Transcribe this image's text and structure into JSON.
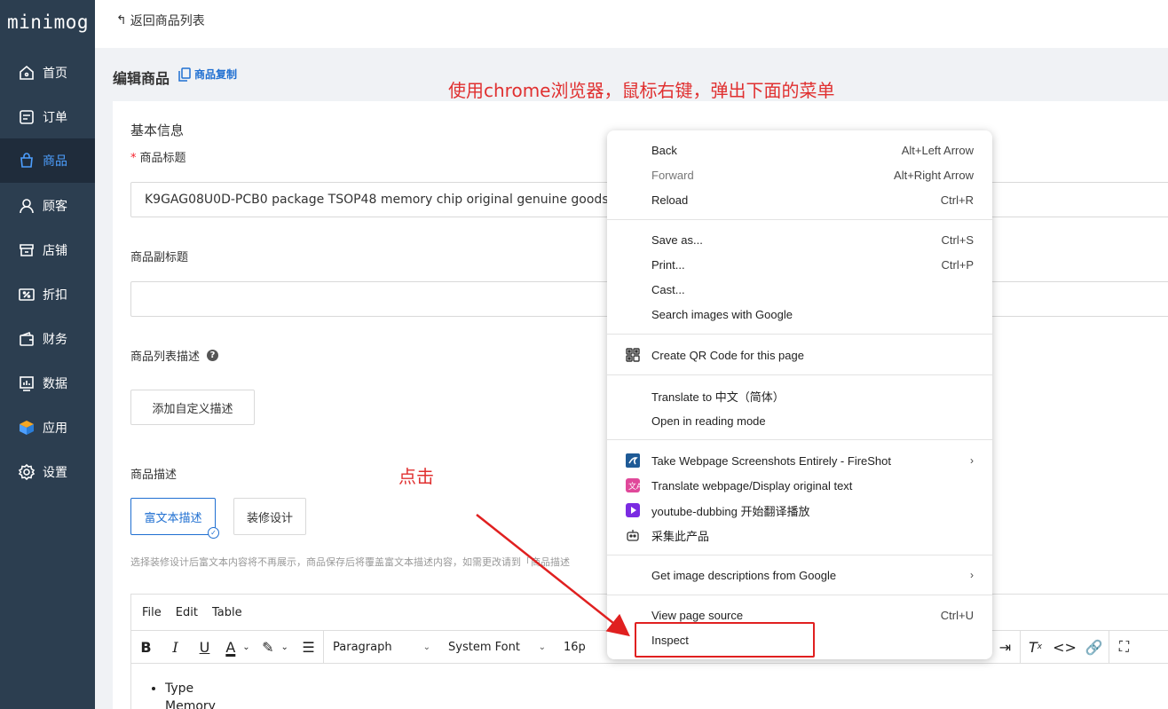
{
  "logo": "minimog",
  "sidebar": {
    "items": [
      {
        "label": "首页",
        "icon": "home-icon"
      },
      {
        "label": "订单",
        "icon": "order-icon"
      },
      {
        "label": "商品",
        "icon": "bag-icon"
      },
      {
        "label": "顾客",
        "icon": "user-icon"
      },
      {
        "label": "店铺",
        "icon": "store-icon"
      },
      {
        "label": "折扣",
        "icon": "discount-icon"
      },
      {
        "label": "财务",
        "icon": "wallet-icon"
      },
      {
        "label": "数据",
        "icon": "chart-icon"
      },
      {
        "label": "应用",
        "icon": "box-icon"
      },
      {
        "label": "设置",
        "icon": "gear-icon"
      }
    ],
    "active_index": 2
  },
  "topbar": {
    "back_label": "返回商品列表"
  },
  "page": {
    "title": "编辑商品",
    "copy_label": "商品复制"
  },
  "annotations": {
    "top": "使用chrome浏览器，鼠标右键，弹出下面的菜单",
    "click": "点击"
  },
  "form": {
    "section_title": "基本信息",
    "title_label": "商品标题",
    "title_value": "K9GAG08U0D-PCB0 package TSOP48 memory chip original genuine goods",
    "subtitle_label": "商品副标题",
    "subtitle_value": "",
    "list_desc_label": "商品列表描述",
    "add_custom_desc": "添加自定义描述",
    "desc_label": "商品描述",
    "tab_rich": "富文本描述",
    "tab_design": "装修设计",
    "hint": "选择装修设计后富文本内容将不再展示，商品保存后将覆盖富文本描述内容，如需更改请到「商品描述"
  },
  "editor": {
    "menus": [
      "File",
      "Edit",
      "Table"
    ],
    "block_format": "Paragraph",
    "font_family": "System Font",
    "font_size": "16p",
    "content": [
      "Type",
      "Memory"
    ]
  },
  "context_menu": {
    "groups": [
      [
        {
          "label": "Back",
          "shortcut": "Alt+Left Arrow"
        },
        {
          "label": "Forward",
          "shortcut": "Alt+Right Arrow",
          "disabled": true
        },
        {
          "label": "Reload",
          "shortcut": "Ctrl+R"
        }
      ],
      [
        {
          "label": "Save as...",
          "shortcut": "Ctrl+S"
        },
        {
          "label": "Print...",
          "shortcut": "Ctrl+P"
        },
        {
          "label": "Cast...",
          "shortcut": ""
        },
        {
          "label": "Search images with Google",
          "shortcut": ""
        }
      ],
      [
        {
          "label": "Create QR Code for this page",
          "shortcut": "",
          "icon": "qr-icon"
        }
      ],
      [
        {
          "label": "Translate to 中文（简体）",
          "shortcut": ""
        },
        {
          "label": "Open in reading mode",
          "shortcut": ""
        }
      ],
      [
        {
          "label": "Take Webpage Screenshots Entirely - FireShot",
          "shortcut": "",
          "icon": "fireshot-icon",
          "submenu": true
        },
        {
          "label": "Translate webpage/Display original text",
          "shortcut": "",
          "icon": "translate-icon"
        },
        {
          "label": "youtube-dubbing 开始翻译播放",
          "shortcut": "",
          "icon": "play-icon"
        },
        {
          "label": "采集此产品",
          "shortcut": "",
          "icon": "robot-icon"
        }
      ],
      [
        {
          "label": "Get image descriptions from Google",
          "shortcut": "",
          "submenu": true
        }
      ],
      [
        {
          "label": "View page source",
          "shortcut": "Ctrl+U"
        },
        {
          "label": "Inspect",
          "shortcut": ""
        }
      ]
    ]
  },
  "colors": {
    "sidebar_bg": "#2c3e50",
    "active_nav": "#4d9fff",
    "annotation_red": "#e03030",
    "link_blue": "#1f6fd1"
  }
}
